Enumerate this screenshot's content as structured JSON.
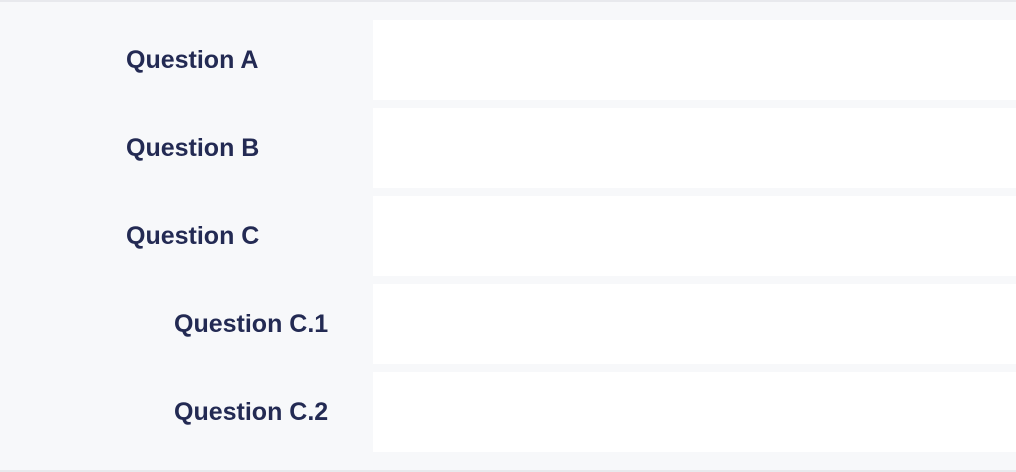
{
  "questions": [
    {
      "label": "Question A",
      "level": 0,
      "answer": ""
    },
    {
      "label": "Question B",
      "level": 0,
      "answer": ""
    },
    {
      "label": "Question C",
      "level": 0,
      "answer": ""
    },
    {
      "label": "Question C.1",
      "level": 1,
      "answer": ""
    },
    {
      "label": "Question C.2",
      "level": 1,
      "answer": ""
    }
  ]
}
